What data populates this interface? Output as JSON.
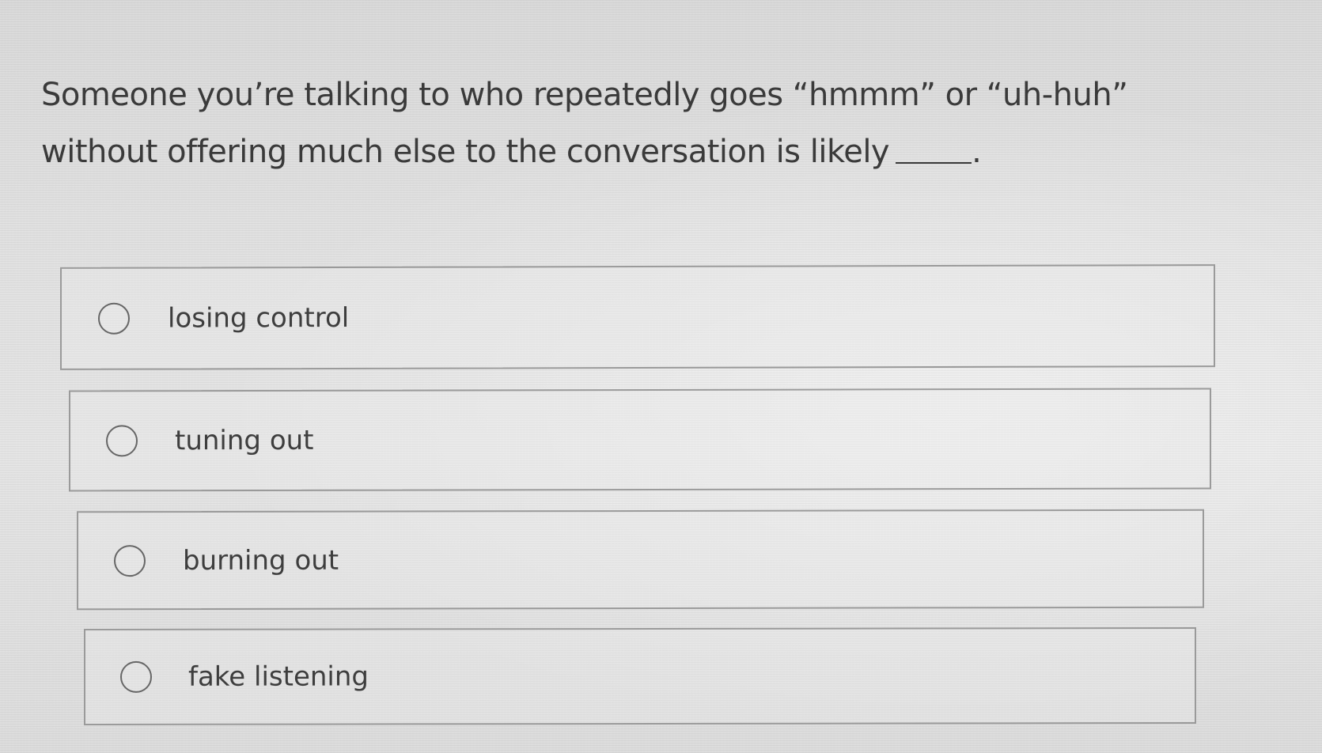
{
  "question": {
    "text": "Someone you’re talking to who repeatedly goes “hmmm” or “uh-huh” without offering much else to the conversation is likely",
    "end_punctuation": "."
  },
  "options": [
    {
      "label": "losing control",
      "selected": false
    },
    {
      "label": "tuning out",
      "selected": false
    },
    {
      "label": "burning out",
      "selected": false
    },
    {
      "label": "fake listening",
      "selected": false
    }
  ],
  "colors": {
    "background": "#e0e0e0",
    "text": "#3a3a3a",
    "option_border": "#9a9a9a",
    "radio_border": "#666666"
  },
  "icons": {
    "radio": "radio-unchecked-icon"
  }
}
